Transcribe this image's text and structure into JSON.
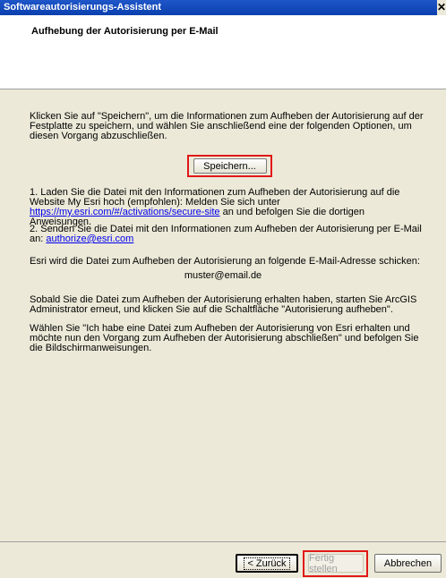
{
  "window": {
    "title": "Softwareautorisierungs-Assistent",
    "close_glyph": "✕"
  },
  "header": {
    "title": "Aufhebung der Autorisierung per E-Mail"
  },
  "body": {
    "intro": "Klicken Sie auf \"Speichern\", um die Informationen zum Aufheben der Autorisierung auf der Festplatte zu speichern, und wählen Sie anschließend eine der folgenden Optionen, um diesen Vorgang abzuschließen.",
    "save_label": "Speichern...",
    "option1_prefix": "1.  Laden Sie die Datei mit den Informationen zum Aufheben der Autorisierung auf die Website My Esri hoch (empfohlen): Melden Sie sich unter ",
    "option1_link": "https://my.esri.com/#/activations/secure-site",
    "option1_suffix": " an und befolgen Sie die dortigen Anweisungen.",
    "option2_prefix": "2.  Senden Sie die Datei mit den Informationen zum Aufheben der Autorisierung per E-Mail an: ",
    "option2_link": "authorize@esri.com",
    "esri_send_text": "Esri wird die Datei zum Aufheben der Autorisierung an folgende E-Mail-Adresse schicken:",
    "email_address": "muster@email.de",
    "after_receive": "Sobald Sie die Datei zum Aufheben der Autorisierung erhalten haben, starten Sie ArcGIS Administrator erneut, und klicken Sie auf die Schaltfläche \"Autorisierung aufheben\".",
    "choose_text": "Wählen Sie \"Ich habe eine Datei zum Aufheben der Autorisierung von Esri erhalten und möchte nun den Vorgang zum Aufheben der Autorisierung abschließen\" und befolgen Sie die Bildschirmanweisungen."
  },
  "footer": {
    "back_label": "< Zurück",
    "finish_label": "Fertig stellen",
    "cancel_label": "Abbrechen"
  },
  "colors": {
    "highlight": "#e11818",
    "link": "#0000ee",
    "titlebar": "#0a3fae"
  }
}
